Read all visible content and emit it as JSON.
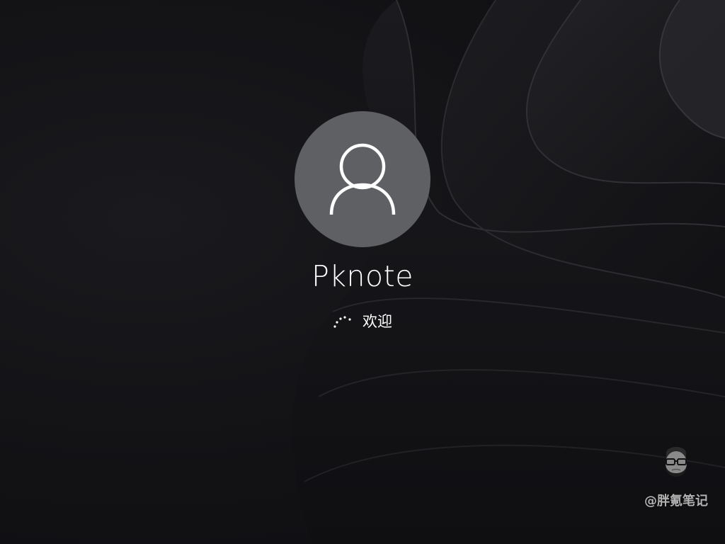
{
  "user": {
    "name": "Pknote",
    "avatar_icon": "user-icon"
  },
  "status": {
    "text": "欢迎",
    "spinner_icon": "loading-spinner-icon"
  },
  "watermark": {
    "text": "@胖氪笔记",
    "logo": "bearded-face-logo"
  },
  "colors": {
    "background": "#131316",
    "avatar_fill": "#5f6064",
    "text": "#ffffff"
  }
}
